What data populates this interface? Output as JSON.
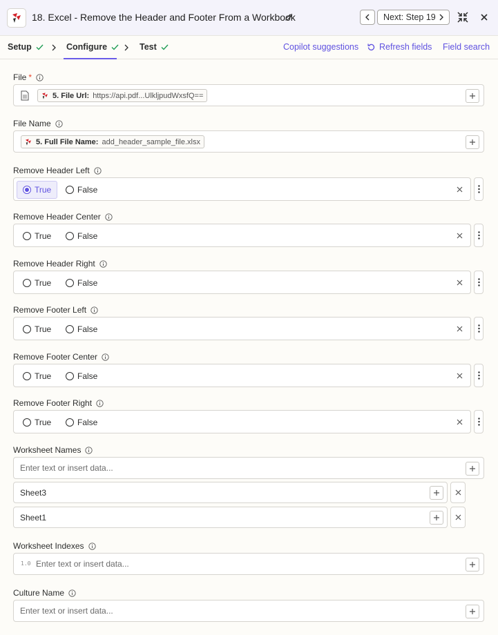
{
  "header": {
    "title": "18. Excel - Remove the Header and Footer From a Workbook",
    "next_label": "Next: Step 19"
  },
  "tabs": [
    {
      "label": "Setup"
    },
    {
      "label": "Configure"
    },
    {
      "label": "Test"
    }
  ],
  "tools": {
    "copilot": "Copilot suggestions",
    "refresh": "Refresh fields",
    "search": "Field search"
  },
  "fields": {
    "file": {
      "label": "File",
      "required": "*",
      "pill_key": "5. File Url:",
      "pill_value": "https://api.pdf...UlkljpudWxsfQ=="
    },
    "file_name": {
      "label": "File Name",
      "pill_key": "5. Full File Name:",
      "pill_value": "add_header_sample_file.xlsx"
    },
    "remove_header_left": {
      "label": "Remove Header Left",
      "selected": "True"
    },
    "remove_header_center": {
      "label": "Remove Header Center",
      "selected": ""
    },
    "remove_header_right": {
      "label": "Remove Header Right",
      "selected": ""
    },
    "remove_footer_left": {
      "label": "Remove Footer Left",
      "selected": ""
    },
    "remove_footer_center": {
      "label": "Remove Footer Center",
      "selected": ""
    },
    "remove_footer_right": {
      "label": "Remove Footer Right",
      "selected": ""
    },
    "worksheet_names": {
      "label": "Worksheet Names",
      "placeholder": "Enter text or insert data...",
      "items": [
        "Sheet3",
        "Sheet1"
      ]
    },
    "worksheet_indexes": {
      "label": "Worksheet Indexes",
      "placeholder": "Enter text or insert data...",
      "type_badge": "1.0"
    },
    "culture_name": {
      "label": "Culture Name",
      "placeholder": "Enter text or insert data..."
    }
  },
  "options": {
    "true_label": "True",
    "false_label": "False"
  },
  "colors": {
    "accent": "#695be8",
    "success": "#1f9d55",
    "brand_red": "#d3222a"
  }
}
